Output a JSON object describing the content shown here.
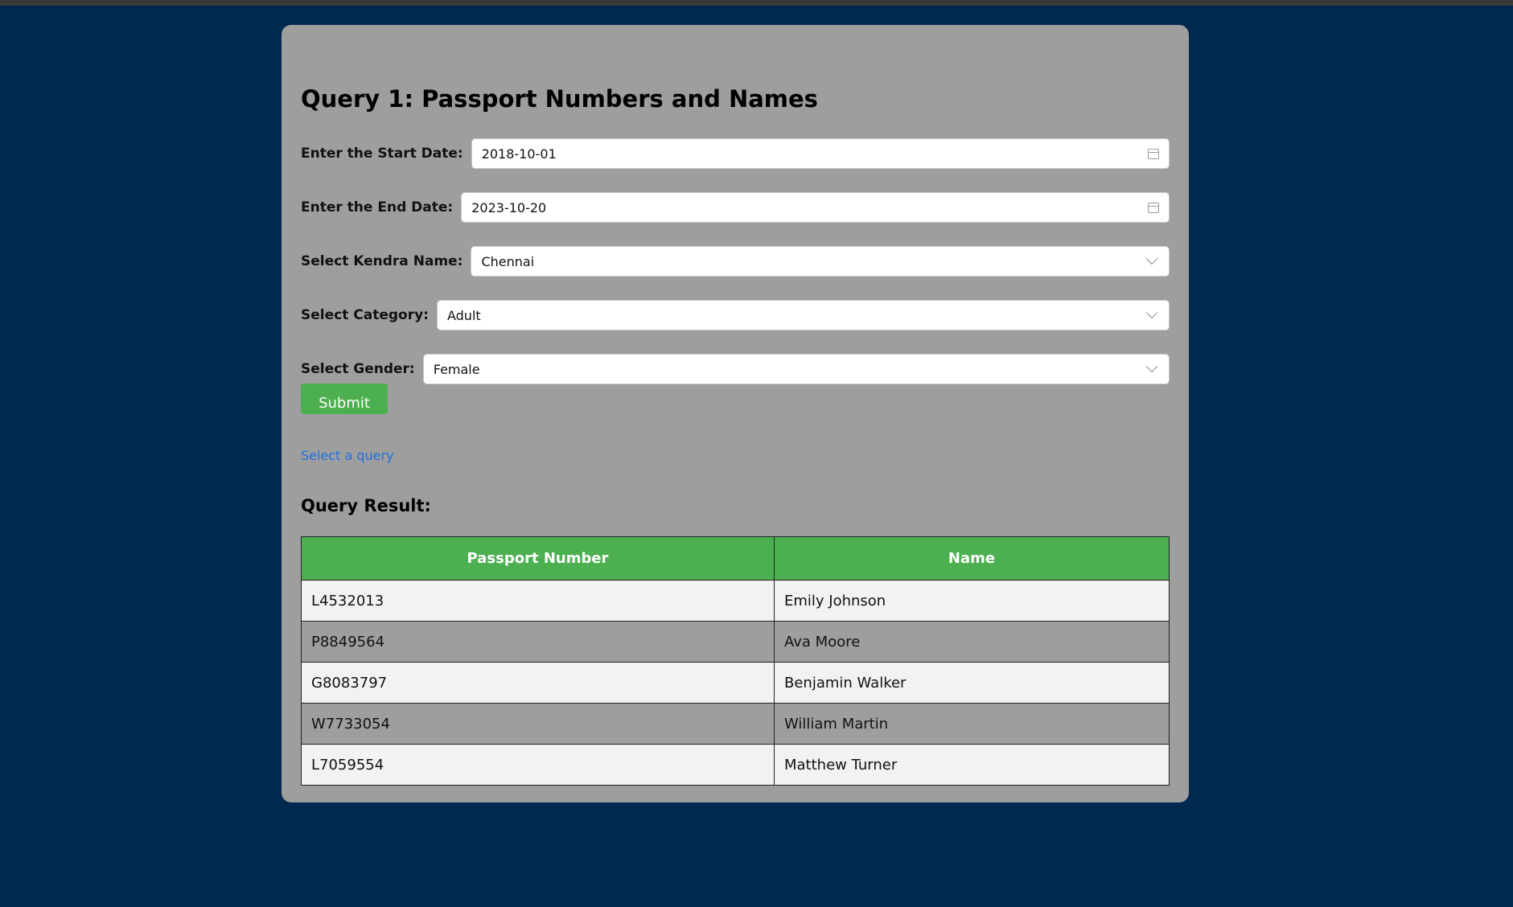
{
  "page": {
    "title": "Query 1: Passport Numbers and Names"
  },
  "form": {
    "start_date": {
      "label": "Enter the Start Date",
      "value": "2018-10-01"
    },
    "end_date": {
      "label": "Enter the End Date",
      "value": "2023-10-20"
    },
    "kendra": {
      "label": "Select Kendra Name",
      "value": "Chennai"
    },
    "category": {
      "label": "Select Category",
      "value": "Adult"
    },
    "gender": {
      "label": "Select Gender",
      "value": "Female"
    },
    "submit_label": "Submit"
  },
  "links": {
    "select_query": "Select a query"
  },
  "result": {
    "title": "Query Result:",
    "columns": [
      "Passport Number",
      "Name"
    ],
    "rows": [
      {
        "passport": "L4532013",
        "name": "Emily Johnson"
      },
      {
        "passport": "P8849564",
        "name": "Ava Moore"
      },
      {
        "passport": "G8083797",
        "name": "Benjamin Walker"
      },
      {
        "passport": "W7733054",
        "name": "William Martin"
      },
      {
        "passport": "L7059554",
        "name": "Matthew Turner"
      }
    ]
  },
  "colors": {
    "background": "#01284f",
    "card": "#9e9e9e",
    "accent": "#4caf50",
    "link": "#1e6fe0"
  }
}
